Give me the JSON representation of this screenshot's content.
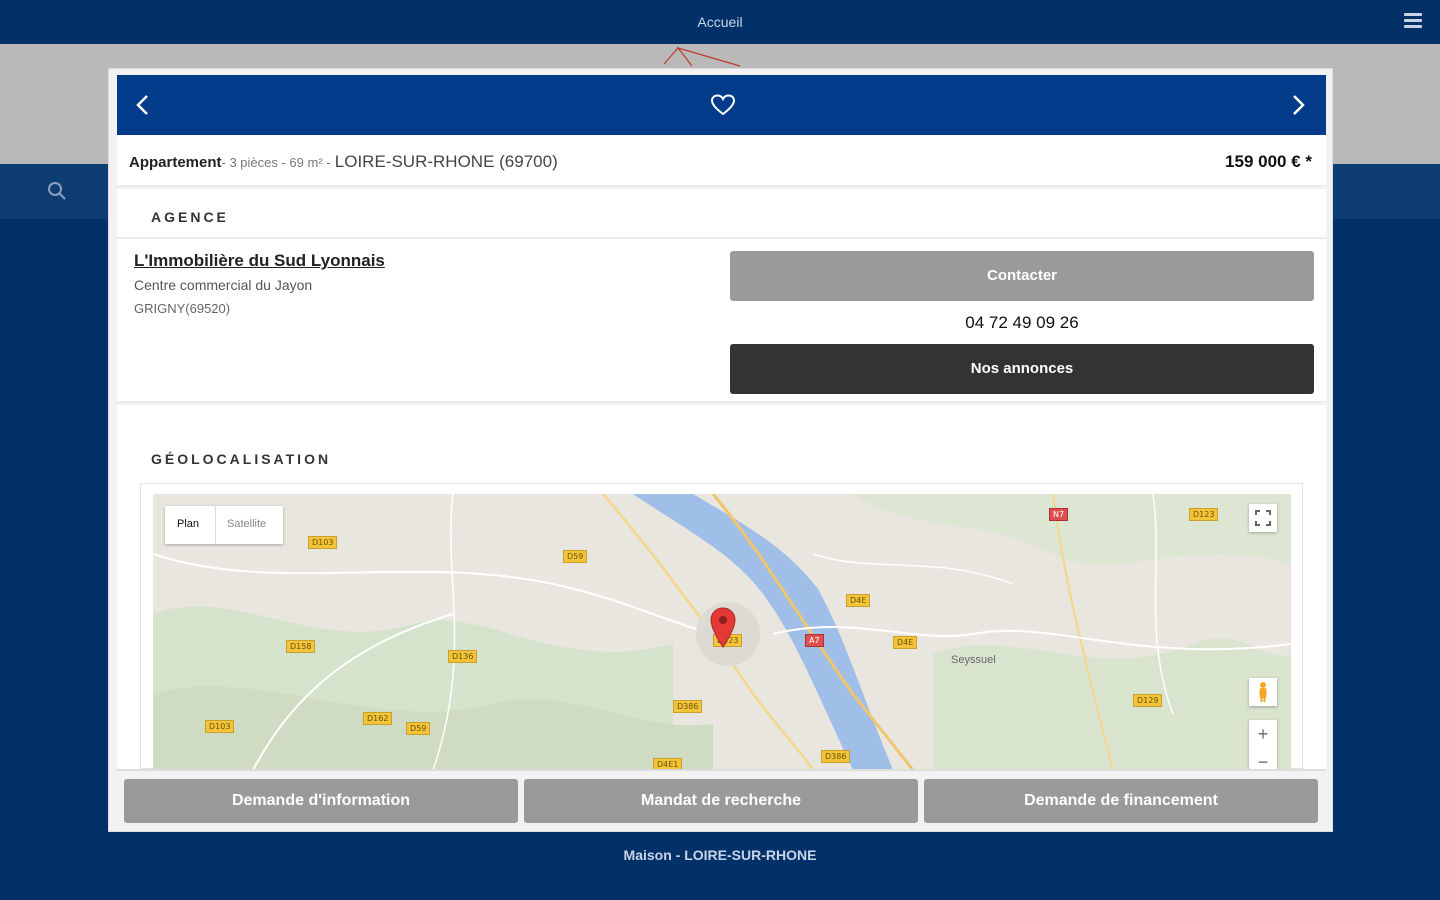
{
  "app": {
    "title": "Accueil",
    "bottom_label": "Maison - LOIRE-SUR-RHONE"
  },
  "icons": {
    "menu": "hamburger-icon",
    "search": "search-icon",
    "prev": "chevron-left-icon",
    "next": "chevron-right-icon",
    "favorite": "heart-icon",
    "fullscreen": "fullscreen-icon",
    "streetview": "pegman-icon",
    "location": "map-pin-icon"
  },
  "colors": {
    "navy": "#023169",
    "header_blue": "#023b8a",
    "button_grey": "#9a9a9a",
    "button_dark": "#333333",
    "pin_red": "#e53935"
  },
  "listing": {
    "type": "Appartement",
    "meta": "- 3 pièces - 69 m² -",
    "city": "LOIRE-SUR-RHONE (69700)",
    "price": "159 000 € *"
  },
  "agency": {
    "section_title": "AGENCE",
    "name": "L'Immobilière du Sud Lyonnais",
    "address": "Centre commercial du Jayon",
    "city": "GRIGNY(69520)",
    "contact_label": "Contacter",
    "phone": "04 72 49 09 26",
    "listings_label": "Nos annonces"
  },
  "geo": {
    "section_title": "GÉOLOCALISATION",
    "map_type_plan": "Plan",
    "map_type_satellite": "Satellite",
    "zoom_in": "+",
    "zoom_out": "−",
    "town": "Seyssuel",
    "roads": [
      "D103",
      "D59",
      "D158",
      "D136",
      "D162",
      "D103",
      "D59",
      "D4E",
      "A7",
      "D4E",
      "D123",
      "D129",
      "D386",
      "D4E1",
      "D386",
      "N7",
      "D123"
    ]
  },
  "footer": {
    "info_label": "Demande d'information",
    "mandat_label": "Mandat de recherche",
    "financement_label": "Demande de financement"
  }
}
